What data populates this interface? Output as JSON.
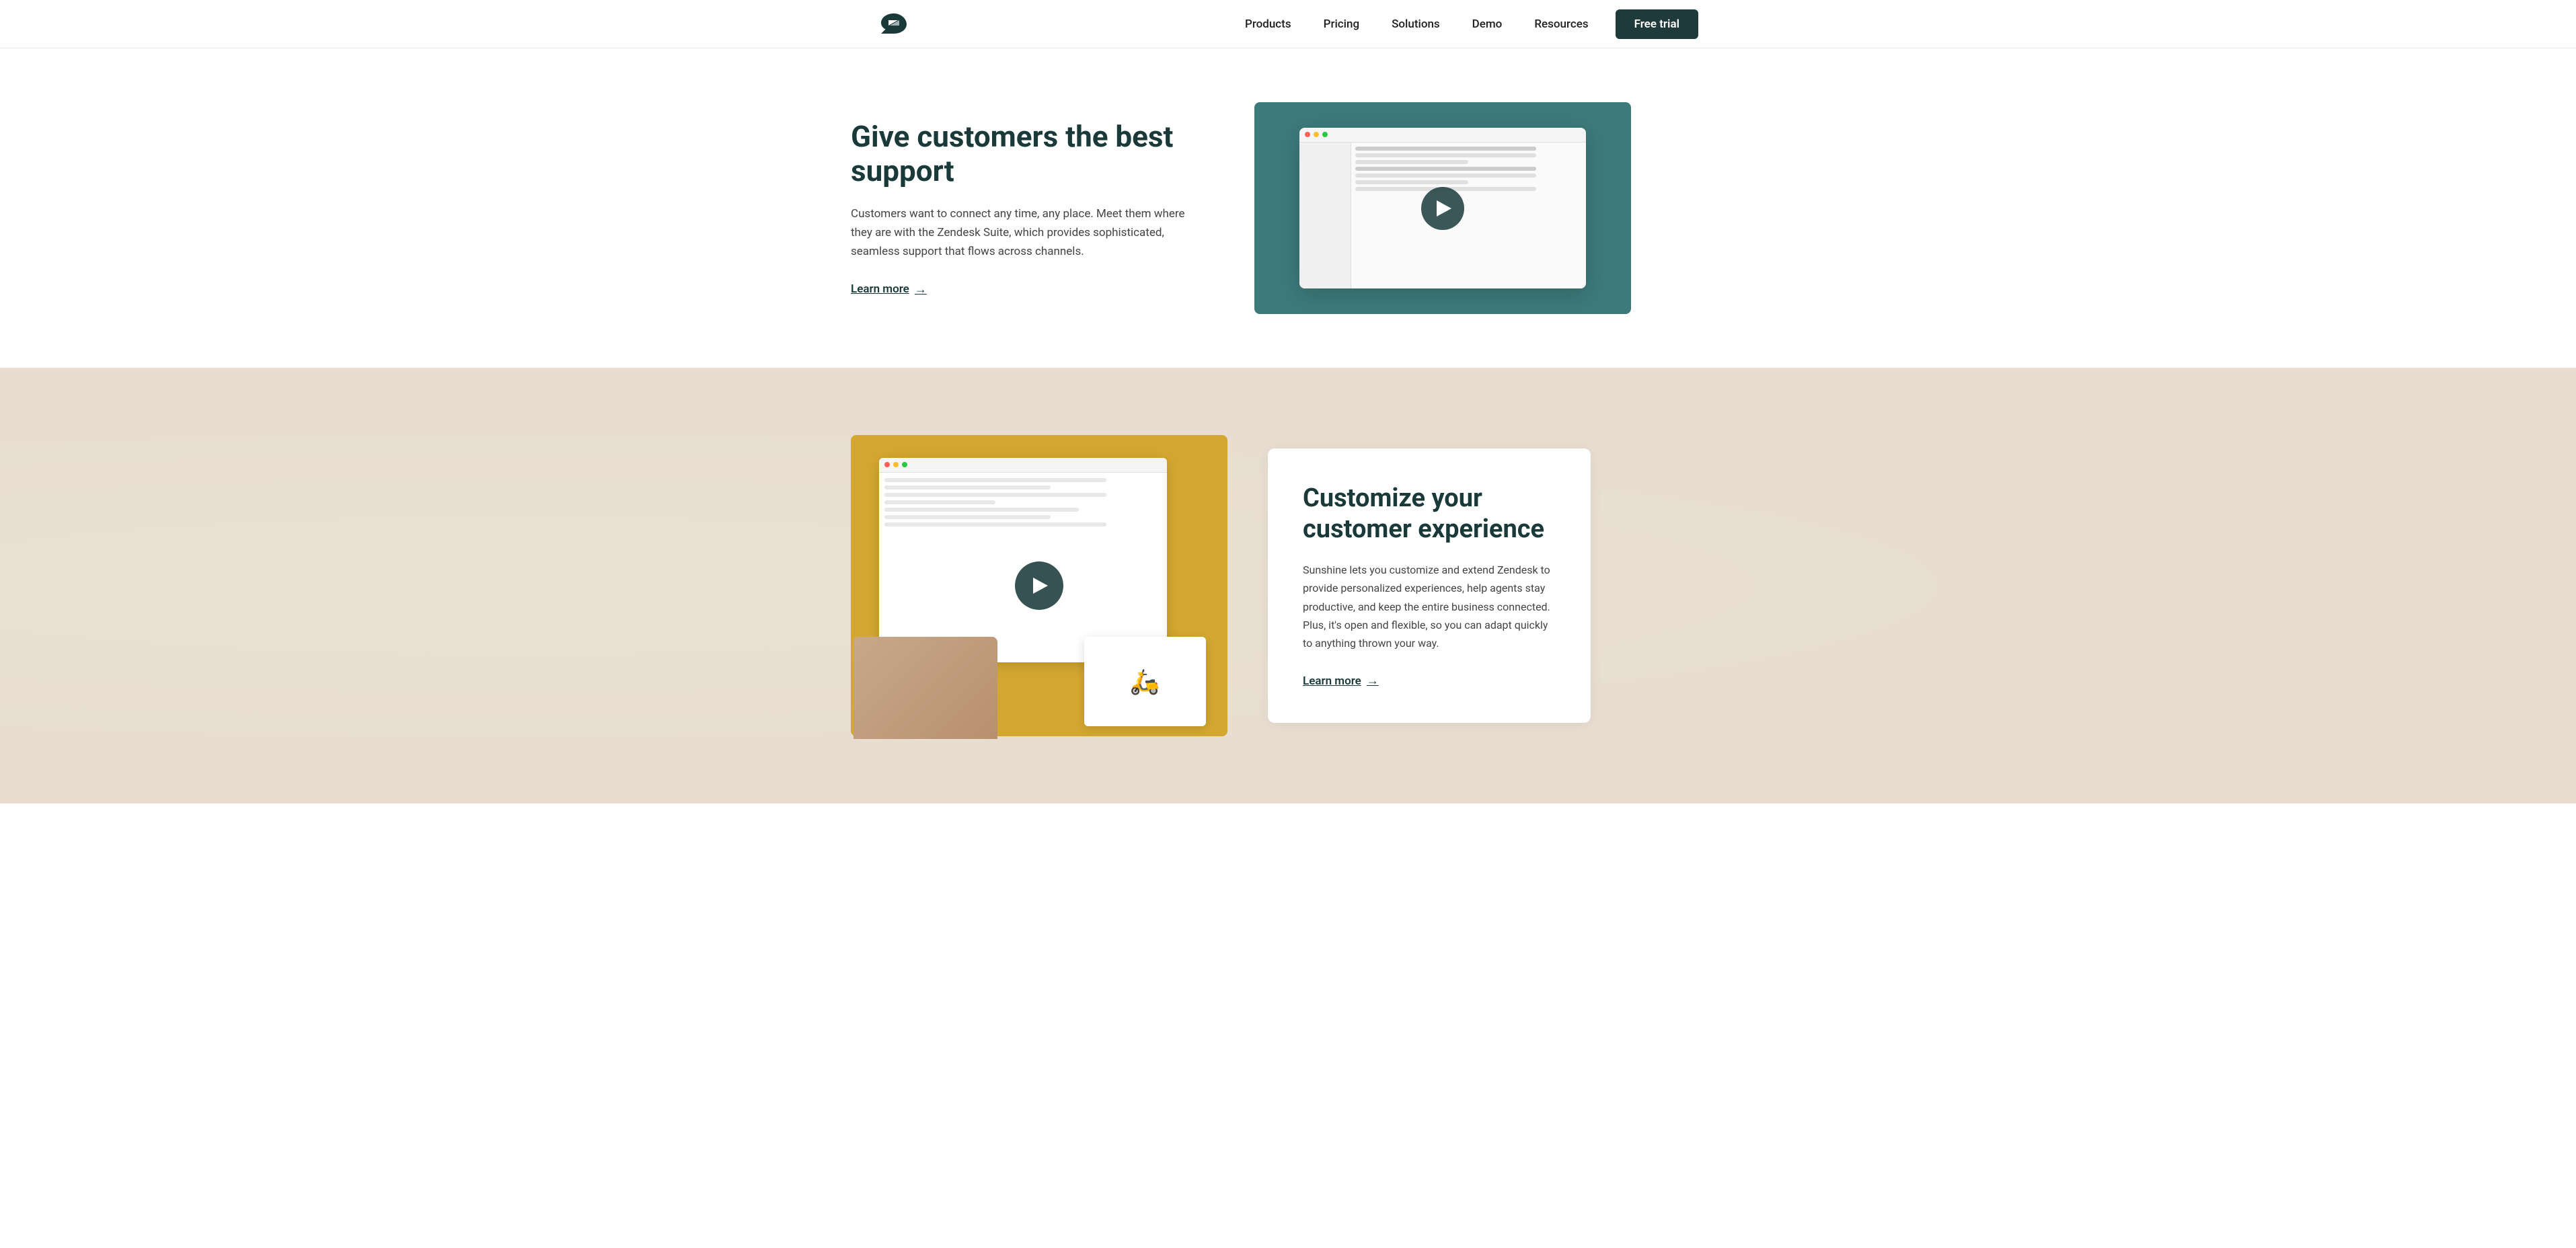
{
  "navbar": {
    "logo_alt": "Zendesk logo",
    "nav_items": [
      {
        "label": "Products",
        "id": "products"
      },
      {
        "label": "Pricing",
        "id": "pricing"
      },
      {
        "label": "Solutions",
        "id": "solutions"
      },
      {
        "label": "Demo",
        "id": "demo"
      },
      {
        "label": "Resources",
        "id": "resources"
      }
    ],
    "cta_label": "Free trial"
  },
  "section_support": {
    "heading_line1": "Give customers the best",
    "heading_line2": "support",
    "body_text": "Customers want to connect any time, any place. Meet them where they are with the Zendesk Suite, which provides sophisticated, seamless support that flows across channels.",
    "learn_more_label": "Learn more",
    "video_alt": "Zendesk support product demo video"
  },
  "section_customize": {
    "heading": "Customize your customer experience",
    "body_text": "Sunshine lets you customize and extend Zendesk to provide personalized experiences, help agents stay productive, and keep the entire business connected. Plus, it's open and flexible, so you can adapt quickly to anything thrown your way.",
    "learn_more_label": "Learn more",
    "video_alt": "Zendesk Sunshine customization demo video"
  },
  "icons": {
    "play": "▶",
    "arrow_right": "→",
    "scooter": "🛵"
  }
}
